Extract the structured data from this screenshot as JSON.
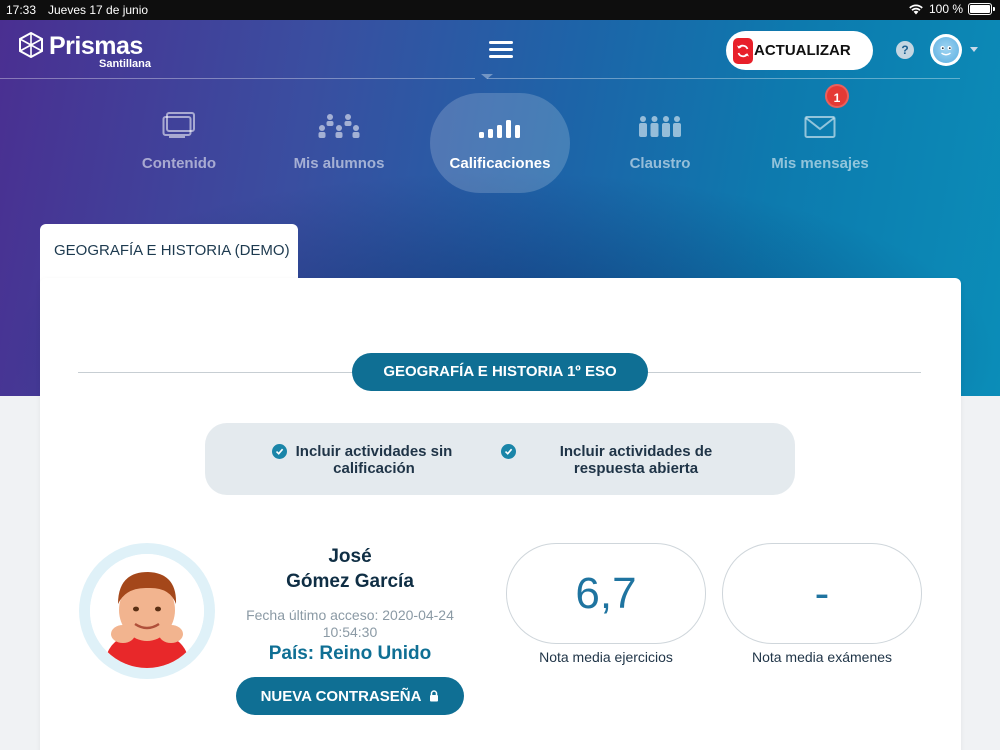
{
  "status_bar": {
    "time": "17:33",
    "date": "Jueves 17 de junio",
    "battery": "100 %"
  },
  "brand": {
    "name": "Prismas",
    "sub": "Santillana"
  },
  "header": {
    "update_label": "ACTUALIZAR"
  },
  "nav": {
    "items": [
      {
        "label": "Contenido",
        "icon": "content-icon",
        "active": false
      },
      {
        "label": "Mis alumnos",
        "icon": "students-icon",
        "active": false
      },
      {
        "label": "Calificaciones",
        "icon": "grades-icon",
        "active": true
      },
      {
        "label": "Claustro",
        "icon": "staff-icon",
        "active": false
      },
      {
        "label": "Mis mensajes",
        "icon": "mail-icon",
        "active": false
      }
    ],
    "messages_badge": "1"
  },
  "tab": {
    "label": "GEOGRAFÍA E HISTORIA (DEMO)"
  },
  "course": {
    "label": "GEOGRAFÍA E HISTORIA 1º ESO"
  },
  "filters": [
    {
      "label": "Incluir actividades sin calificación",
      "checked": true
    },
    {
      "label": "Incluir actividades de respuesta abierta",
      "checked": true
    }
  ],
  "student": {
    "first_name": "José",
    "last_name": "Gómez García",
    "last_access": "Fecha último acceso: 2020-04-24 10:54:30",
    "country": "País: Reino Unido",
    "password_button": "NUEVA CONTRASEÑA"
  },
  "scores": [
    {
      "value": "6,7",
      "label": "Nota media ejercicios"
    },
    {
      "value": "-",
      "label": "Nota media exámenes"
    }
  ],
  "colors": {
    "primary": "#0f6f94",
    "accent_red": "#e8202a",
    "badge_red": "#e53935"
  }
}
